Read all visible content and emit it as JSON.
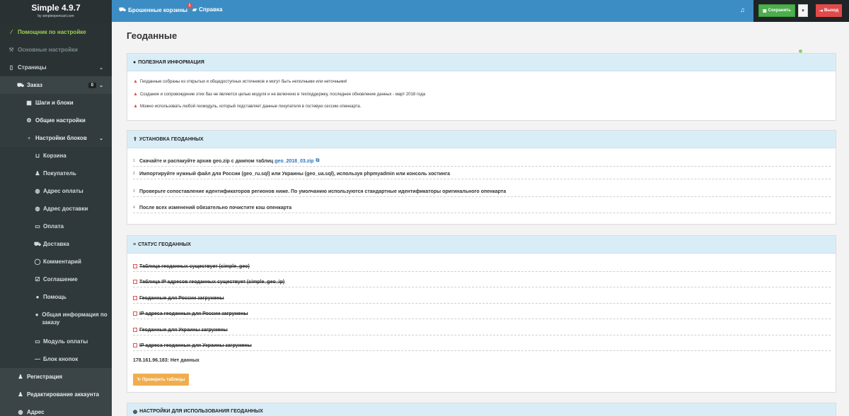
{
  "brand": {
    "title": "Simple 4.9.7",
    "subtitle": "by simpleopencart.com"
  },
  "topbar": {
    "abandoned_carts": "Брошенные корзины",
    "abandoned_badge": "1",
    "help": "Справка",
    "save": "Сохранить",
    "caret": "▾",
    "exit": "Выход"
  },
  "sidebar": {
    "setup_wizard": "Помощник по настройке",
    "main_settings": "Основные настройки",
    "pages": "Страницы",
    "order": "Заказ",
    "order_badge": "0",
    "steps": "Шаги и блоки",
    "general_settings": "Общие настройки",
    "block_settings": "Настройки блоков",
    "blocks": [
      "Корзина",
      "Покупатель",
      "Адрес оплаты",
      "Адрес доставки",
      "Оплата",
      "Доставка",
      "Комментарий",
      "Соглашение",
      "Помощь",
      "Общая информация по заказу",
      "Модуль оплаты",
      "Блок кнопок"
    ],
    "registration": "Регистрация",
    "edit_account": "Редактирование аккаунта",
    "address": "Адрес"
  },
  "page": {
    "title": "Геоданные"
  },
  "info_panel": {
    "heading": "ПОЛЕЗНАЯ ИНФОРМАЦИЯ",
    "lines": [
      "Геоданные собраны из открытых и общедоступных источников и могут быть неполными или неточными!",
      "Создание и сопровождение этих баз не является целью модуля и не включено в техподдержку, последнее обновление данных - март 2018 года",
      "Можно использовать любой геомодуль, который подставляет данные покупателя в гостевую сессию опенкарта."
    ]
  },
  "install_panel": {
    "heading": "УСТАНОВКА ГЕОДАННЫХ",
    "steps": [
      {
        "num": "1",
        "text": "Скачайте и распакуйте архив geo.zip с дампом таблиц ",
        "link": "geo_2018_03.zip"
      },
      {
        "num": "2",
        "text": "Импортируйте нужный файл для России (geo_ru.sql) или Украины (geo_ua.sql), используя phpmyadmin или консоль хостинга"
      },
      {
        "num": "3",
        "text": "Проверьте сопоставление идентификаторов регионов ниже. По умолчанию используются стандартные идентификаторы оригинального опенкарта"
      },
      {
        "num": "4",
        "text": "После всех изменений обязательно почистите кэш опенкарта"
      }
    ]
  },
  "status_panel": {
    "heading": "СТАТУС ГЕОДАННЫХ",
    "items": [
      "Таблица геоданных существует (simple_geo)",
      "Таблица IP адресов геоданных существует (simple_geo_ip)",
      "Геоданные для России загружены",
      "IP адреса геоданных для России загружены",
      "Геоданные для Украины загружены",
      "IP адреса геоданных для Украины загружены"
    ],
    "ip_line": "178.161.96.183: Нет данных",
    "check_button": "Проверить таблицы"
  },
  "usage_panel": {
    "heading": "НАСТРОЙКИ ДЛЯ ИСПОЛЬЗОВАНИЯ ГЕОДАННЫХ"
  },
  "colors": {
    "accent": "#3c8dc4",
    "sidebar": "#3b4548",
    "save": "#4cae4c",
    "exit": "#e04a4a",
    "warning": "#f0ad4e"
  }
}
